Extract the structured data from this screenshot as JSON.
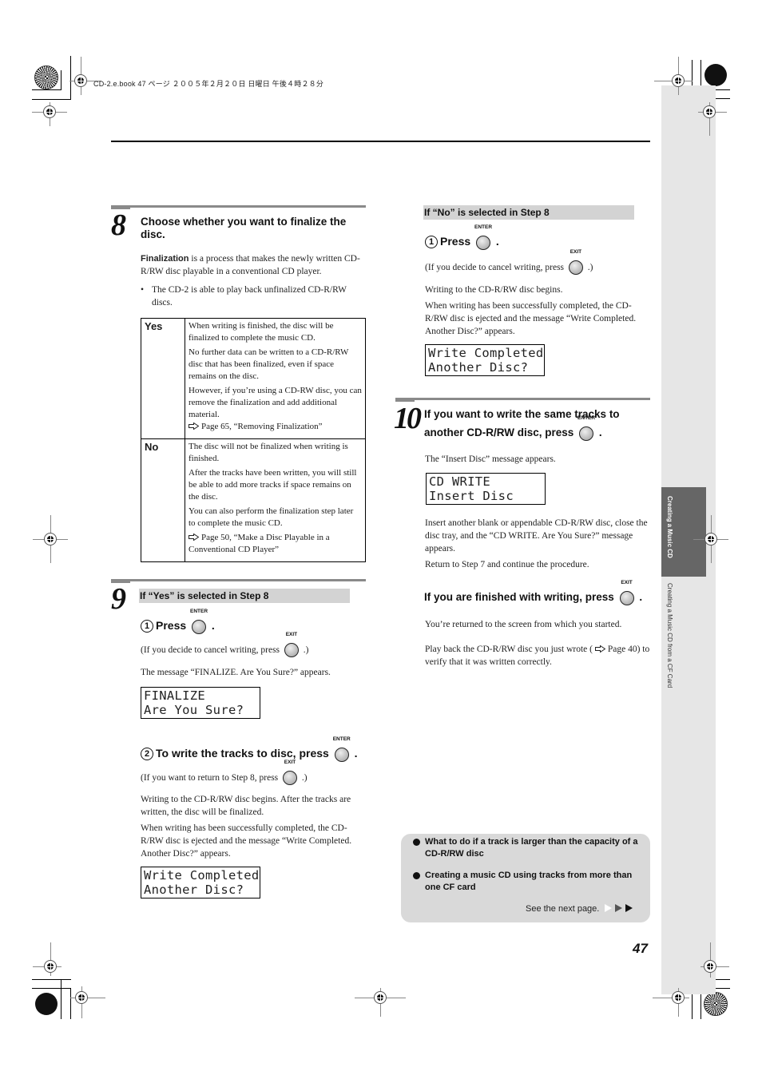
{
  "header": {
    "book_info": "CD-2.e.book  47 ページ  ２００５年２月２０日  日曜日  午後４時２８分"
  },
  "sidebar": {
    "tab_label": "Creating a Music CD",
    "chapter_title": "Creating a Music CD from a CF Card"
  },
  "icons": {
    "enter_label": "ENTER",
    "exit_label": "EXIT"
  },
  "step8": {
    "number": "8",
    "title": "Choose whether you want to finalize the disc.",
    "intro_bold": "Finalization",
    "intro_rest": " is a process that makes the newly written CD-R/RW disc playable in a conventional CD player.",
    "bullet": "The CD-2 is able to play back unfinalized CD-R/RW discs.",
    "options": [
      {
        "key": "Yes",
        "paragraphs": [
          "When writing is finished, the disc will be finalized to complete the music CD.",
          "No further data can be written to a CD-R/RW disc that has been finalized, even if space remains on the disc.",
          "However, if you’re using a CD-RW disc, you can remove the finalization and add additional material."
        ],
        "reference": "Page 65, “Removing Finalization”"
      },
      {
        "key": "No",
        "paragraphs": [
          "The disc will not be finalized when writing is finished.",
          "After the tracks have been written, you will still be able to add more tracks if space remains on the disc.",
          "You can also perform the finalization step later to complete the music CD."
        ],
        "reference": "Page 50, “Make a Disc Playable in a Conventional CD Player”"
      }
    ]
  },
  "step9": {
    "number": "9",
    "heading": "If “Yes” is selected in Step 8",
    "sub1": {
      "marker": "1",
      "label": "Press",
      "note_before": "(If you decide to cancel writing, press",
      "note_after": ".)",
      "message": "The message “FINALIZE. Are You Sure?” appears.",
      "lcd": [
        "FINALIZE",
        "Are You Sure?"
      ]
    },
    "sub2": {
      "marker": "2",
      "label": "To write the tracks to disc, press",
      "note_before": "(If you want to return to Step 8, press",
      "note_after": ".)",
      "paragraphs": [
        "Writing to the CD-R/RW disc begins. After the tracks are written, the disc will be finalized.",
        "When writing has been successfully completed, the CD-R/RW disc is ejected and the message “Write Completed. Another Disc?” appears."
      ],
      "lcd": [
        "Write Completed",
        "Another Disc?"
      ]
    }
  },
  "no_branch": {
    "heading": "If “No” is selected in Step 8",
    "marker": "1",
    "label": "Press",
    "note_before": "(If you decide to cancel writing, press",
    "note_after": ".)",
    "paragraphs": [
      "Writing to the CD-R/RW disc begins.",
      "When writing has been successfully completed, the CD-R/RW disc is ejected and the message “Write Completed. Another Disc?” appears."
    ],
    "lcd": [
      "Write Completed",
      "Another Disc?"
    ]
  },
  "step10": {
    "number": "10",
    "title_line1": "If you want to write the same tracks to",
    "title_line2": "another CD-R/RW disc, press",
    "message": "The “Insert Disc” message appears.",
    "lcd": [
      "CD WRITE",
      "Insert Disc"
    ],
    "paragraphs": [
      "Insert another blank or appendable CD-R/RW disc, close the disc tray, and the “CD WRITE. Are You Sure?” message appears.",
      "Return to Step 7 and continue the procedure."
    ],
    "finished_title": "If you are finished with writing, press",
    "finished_note": "You’re returned to the screen from which you started.",
    "playback_before": "Play back the CD-R/RW disc you just wrote (",
    "playback_after": "Page 40) to verify that it was written correctly."
  },
  "info_box": {
    "items": [
      "What to do if a track is larger than the capacity of a CD-R/RW disc",
      "Creating a music CD using tracks from more than one CF card"
    ],
    "next_page": "See the next page."
  },
  "page_number": "47"
}
